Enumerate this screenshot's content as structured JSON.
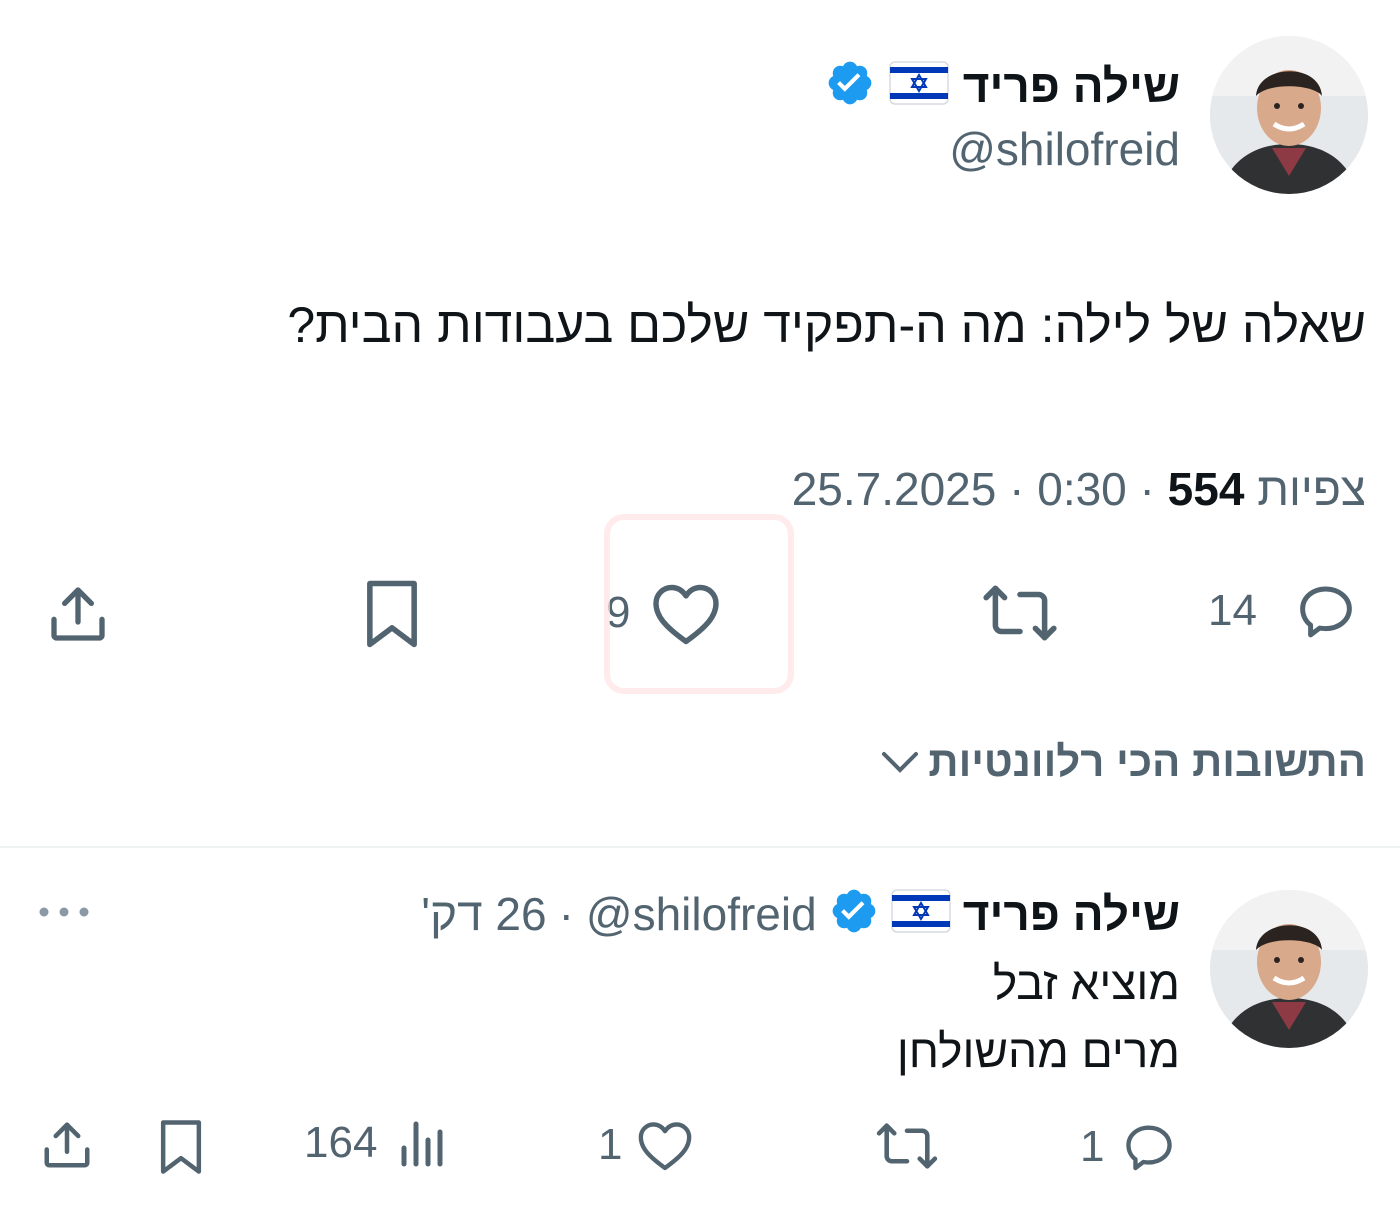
{
  "tweet": {
    "author_name": "שילה פריד",
    "author_handle": "@shilofreid",
    "text": "שאלה של לילה: מה ה-תפקיד שלכם בעבודות הבית?",
    "date": "25.7.2025",
    "time": "0:30",
    "views_count": "554",
    "views_label": "צפיות",
    "replies_count": "14",
    "likes_count": "9"
  },
  "relevant_replies_label": "התשובות הכי רלוונטיות",
  "reply": {
    "author_name": "שילה פריד",
    "author_handle": "@shilofreid",
    "time_ago": "26 דק'",
    "line1": "מוציא זבל",
    "line2": "מרים מהשולחן",
    "replies_count": "1",
    "likes_count": "1",
    "views_count": "164"
  },
  "icons": {
    "verified": "verified-badge-icon",
    "flag": "israel-flag-icon",
    "reply": "reply-bubble-icon",
    "retweet": "retweet-icon",
    "like": "heart-icon",
    "bookmark": "bookmark-icon",
    "share": "share-icon",
    "views": "views-bar-chart-icon",
    "more": "more-dots-icon",
    "chevron": "chevron-down-icon"
  },
  "colors": {
    "primary_text": "#0f1419",
    "secondary_text": "#536471",
    "verified_blue": "#1d9bf0",
    "flag_blue": "#0038b8"
  }
}
